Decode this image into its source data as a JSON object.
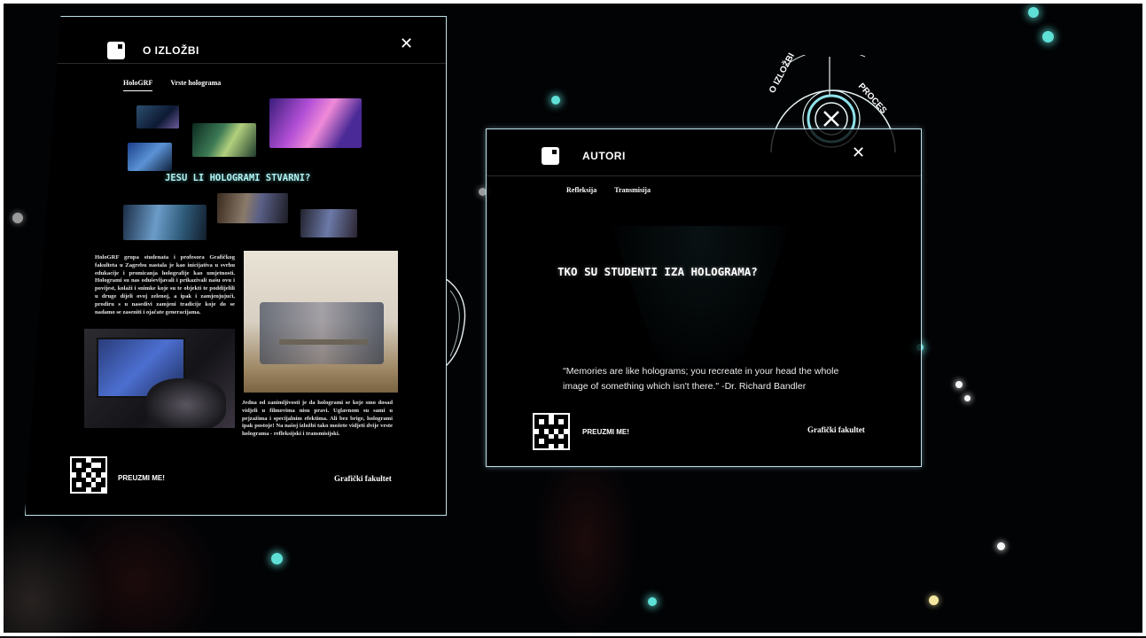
{
  "left_panel": {
    "title": "O IZLOŽBI",
    "close_icon": "close-icon",
    "tabs": [
      "HoloGRF",
      "Vrste holograma"
    ],
    "active_tab": 0,
    "headline": "JESU LI HOLOGRAMI STVARNI?",
    "text_block_1": "HoloGRF grupa studenata i profesora Grafičkog fakulteta u Zagrebu nastala je kao inicijativa u svrhu edukacije i promicanja holografije kao umjetnosti. Hologrami su nas oduševljavali i prikazivali našu ovu i povijest, kolaži i snimke koje su te objekti te poddijelili u druge dijeli ovoj zelenoj, a ipak i zamjenjujući, prodiru s u nasedivi zamjeni tradicije koje do se nadamo se zaseniti i ojačate generacijama.",
    "text_block_2": "Jedna od zanimljivosti je da hologrami se koje smo dosad vidjeli u filmovima nisu pravi. Uglavnom su sami u pejzažima i specijalnim efektima. Ali bez brige, hologrami ipak postoje! Na našoj izložbi tako možete vidjeti dvije vrste holograma - refleksijski i transmisijski.",
    "download_label": "PREUZMI ME!",
    "faculty": "Grafički fakultet"
  },
  "right_panel": {
    "title": "AUTORI",
    "close_icon": "close-icon",
    "tabs": [
      "Refleksija",
      "Transmisija"
    ],
    "headline": "TKO SU STUDENTI IZA HOLOGRAMA?",
    "quote_line_1": "\"Memories are like holograms; you recreate in your head the whole",
    "quote_line_2": "image of something which isn't there.\" -Dr. Richard Bandler",
    "download_label": "PREUZMI ME!",
    "faculty": "Grafički fakultet"
  },
  "dial": {
    "left_label": "O IZLOŽBI",
    "right_label": "PROCES",
    "center_icon": "close-icon"
  },
  "colors": {
    "panel_border": "#bfe3ec",
    "headline": "#aef2f2",
    "particle": "#5fe0d6"
  }
}
